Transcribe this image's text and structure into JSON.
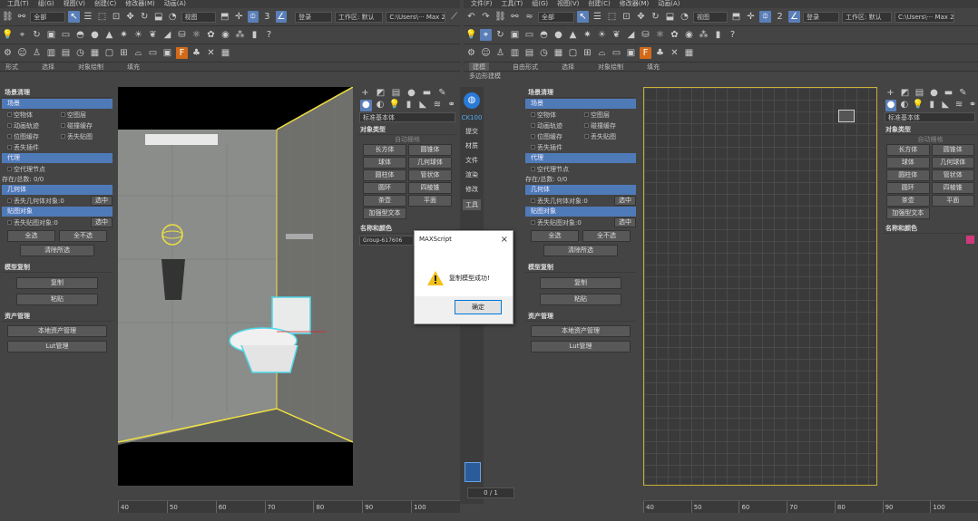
{
  "menu_left": [
    "工具(T)",
    "组(G)",
    "视图(V)",
    "创建(C)",
    "修改器(M)",
    "动画(A)"
  ],
  "menu_right": [
    "文件(F)",
    "工具(T)",
    "组(G)",
    "视图(V)",
    "创建(C)",
    "修改器(M)",
    "动画(A)"
  ],
  "toolbar": {
    "filter": "全部",
    "ref": "视图",
    "login": "登录",
    "workspace": "工作区: 默认",
    "path": "C:\\Users\\··· Max 2020"
  },
  "ribbon_left": [
    "形式",
    "选择",
    "对象绘制",
    "填充"
  ],
  "ribbon_right": [
    "建模",
    "自由形式",
    "选择",
    "对象绘制",
    "填充"
  ],
  "ribbon_sub": "多边形建模",
  "scene_clean": {
    "title": "场景清理",
    "section_scene": "场景",
    "items": [
      "空物体",
      "空图层",
      "动画轨迹",
      "碰撞缓存",
      "位图缓存",
      "丢失贴图",
      "丢失插件"
    ],
    "section_proxy": "代理",
    "proxy_item": "空代理节点",
    "proxy_count": "存在/总数: 0/0",
    "section_geo": "几何体",
    "geo_item": "丢失几何体对象:0",
    "select": "选中",
    "section_map": "贴图对象",
    "map_item": "丢失贴图对象:0",
    "select_all": "全选",
    "select_none": "全不选",
    "clear": "清除所选"
  },
  "model_copy": {
    "title": "模型复制",
    "copy": "复制",
    "paste": "粘贴"
  },
  "asset": {
    "title": "资产管理",
    "local": "本地资产管理",
    "lut": "Lut管理"
  },
  "cmd": {
    "dropdown": "标准基本体",
    "obj_type": "对象类型",
    "autogrid": "自动栅格",
    "buttons": [
      "长方体",
      "圆锥体",
      "球体",
      "几何球体",
      "圆柱体",
      "管状体",
      "圆环",
      "四棱锥",
      "茶壶",
      "平面",
      "加强型文本"
    ],
    "name_color": "名称和颜色",
    "object_name": "Group-617606"
  },
  "side_tabs": [
    "CK100",
    "提交",
    "材质",
    "文件",
    "渲染",
    "修改",
    "工具"
  ],
  "dialog": {
    "title": "MAXScript",
    "message": "复制模型成功!",
    "ok": "确定"
  },
  "frame": "0 / 1",
  "ticks": [
    "40",
    "50",
    "60",
    "70",
    "80",
    "90",
    "100"
  ],
  "colors": {
    "accent": "#4f7ab8",
    "swatch": "#d03a7a",
    "selection": "#f0e040",
    "cyan": "#4fd8e8"
  }
}
